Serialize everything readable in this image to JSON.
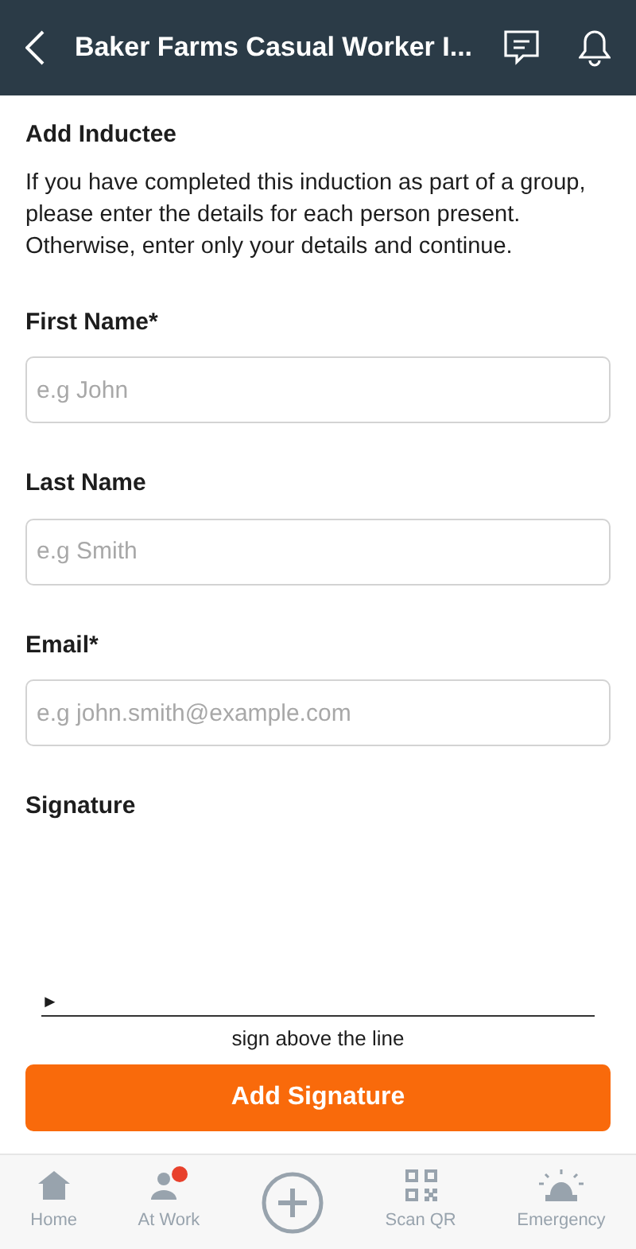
{
  "header": {
    "title": "Baker Farms Casual Worker I..."
  },
  "section_title": "Add Inductee",
  "intro": "If you have completed this induction as part of a group, please enter the details for each person present. Otherwise, enter only your details and continue.",
  "fields": [
    {
      "label": "First Name*",
      "placeholder": "e.g John"
    },
    {
      "label": "Last Name",
      "placeholder": "e.g Smith"
    },
    {
      "label": "Email*",
      "placeholder": "e.g john.smith@example.com"
    }
  ],
  "signature": {
    "label": "Signature",
    "marker": "►",
    "hint": "sign above the line",
    "button": "Add Signature"
  },
  "tab_bar": [
    {
      "kind": "home",
      "label": "Home",
      "badge": false
    },
    {
      "kind": "people",
      "label": "At Work",
      "badge": true
    },
    {
      "kind": "add",
      "badge": false
    },
    {
      "kind": "qr",
      "label": "Scan QR",
      "badge": false
    },
    {
      "kind": "siren",
      "label": "Emergency",
      "badge": false
    }
  ]
}
